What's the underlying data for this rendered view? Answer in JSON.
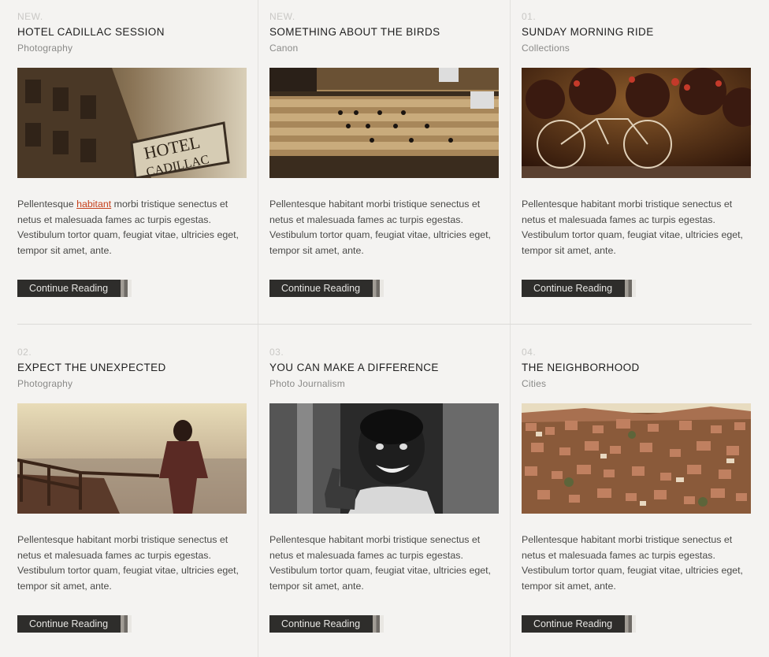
{
  "posts": [
    {
      "num": "NEW.",
      "title": "HOTEL CADILLAC SESSION",
      "category": "Photography",
      "excerpt_before": "Pellentesque ",
      "excerpt_link": "habitant",
      "excerpt_after": " morbi tristique senectus et netus et malesuada fames ac turpis egestas. Vestibulum tortor quam, feugiat vitae, ultricies eget, tempor sit amet, ante.",
      "button": "Continue Reading",
      "image": "hotel-cadillac-sign-photo"
    },
    {
      "num": "NEW.",
      "title": "SOMETHING ABOUT THE BIRDS",
      "category": "Canon",
      "excerpt": "Pellentesque habitant morbi tristique senectus et netus et malesuada fames ac turpis egestas. Vestibulum tortor quam, feugiat vitae, ultricies eget, tempor sit amet, ante.",
      "button": "Continue Reading",
      "image": "birds-on-balcony-photo"
    },
    {
      "num": "01.",
      "title": "SUNDAY MORNING RIDE",
      "category": "Collections",
      "excerpt": "Pellentesque habitant morbi tristique senectus et netus et malesuada fames ac turpis egestas. Vestibulum tortor quam, feugiat vitae, ultricies eget, tempor sit amet, ante.",
      "button": "Continue Reading",
      "image": "bicycle-flowers-photo"
    },
    {
      "num": "02.",
      "title": "EXPECT THE UNEXPECTED",
      "category": "Photography",
      "excerpt": "Pellentesque habitant morbi tristique senectus et netus et malesuada fames ac turpis egestas. Vestibulum tortor quam, feugiat vitae, ultricies eget, tempor sit amet, ante.",
      "button": "Continue Reading",
      "image": "man-overlooking-fog-photo"
    },
    {
      "num": "03.",
      "title": "YOU CAN MAKE A DIFFERENCE",
      "category": "Photo Journalism",
      "excerpt": "Pellentesque habitant morbi tristique senectus et netus et malesuada fames ac turpis egestas. Vestibulum tortor quam, feugiat vitae, ultricies eget, tempor sit amet, ante.",
      "button": "Continue Reading",
      "image": "smiling-boy-thumbs-up-photo"
    },
    {
      "num": "04.",
      "title": "THE NEIGHBORHOOD",
      "category": "Cities",
      "excerpt": "Pellentesque habitant morbi tristique senectus et netus et malesuada fames ac turpis egestas. Vestibulum tortor quam, feugiat vitae, ultricies eget, tempor sit amet, ante.",
      "button": "Continue Reading",
      "image": "hillside-city-photo"
    }
  ],
  "colors": {
    "link": "#c6411c",
    "button_bg": "#2e2d2b",
    "background": "#f4f3f1"
  }
}
